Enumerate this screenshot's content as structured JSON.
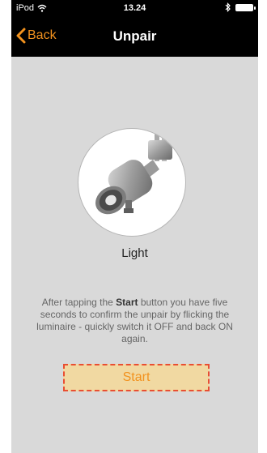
{
  "status_bar": {
    "carrier": "iPod",
    "time": "13.24",
    "icons": [
      "wifi-icon",
      "bluetooth-icon",
      "battery-icon"
    ]
  },
  "nav": {
    "back_label": "Back",
    "title": "Unpair",
    "accent_color": "#f2921e"
  },
  "product": {
    "name": "Light",
    "image": "spotlight-luminaire-icon"
  },
  "instructions": {
    "prefix": "After tapping the ",
    "bold": "Start",
    "suffix": " button you have five seconds to confirm the unpair by flicking the luminaire - quickly switch it OFF and back ON again."
  },
  "start_button": {
    "label": "Start",
    "background": "#f1d9a2",
    "border_color": "#e94e32"
  }
}
